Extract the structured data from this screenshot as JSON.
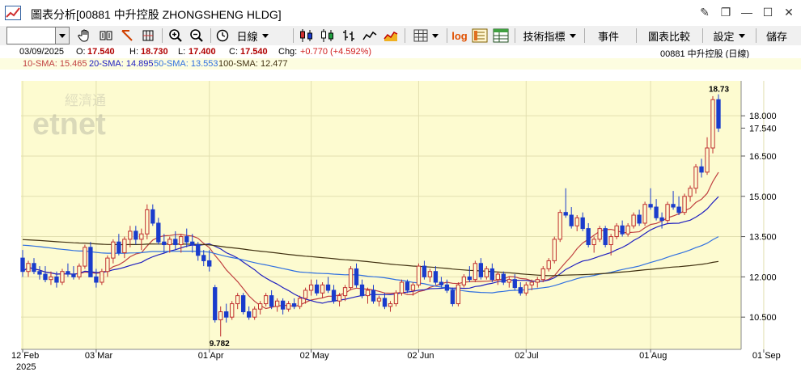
{
  "window": {
    "title": "圖表分析[00881 中升控股 ZHONGSHENG HLDG]",
    "controls": [
      "✎",
      "□",
      "—",
      "□",
      "✕"
    ]
  },
  "toolbar": {
    "period_label": "日線",
    "log_label": "log",
    "indicators_label": "技術指標",
    "events_label": "事件",
    "compare_label": "圖表比較",
    "settings_label": "設定",
    "save_label": "儲存"
  },
  "quote": {
    "date": "03/09/2025",
    "open_label": "O:",
    "open": "17.540",
    "high_label": "H:",
    "high": "18.730",
    "low_label": "L:",
    "low": "17.400",
    "close_label": "C:",
    "close": "17.540",
    "chg_label": "Chg:",
    "chg": "+0.770 (+4.592%)",
    "stock_label": "00881  中升控股 (日線)"
  },
  "sma": {
    "sma10_label": "10-SMA: 15.465",
    "sma20_label": "20-SMA: 14.895",
    "sma50_label": "50-SMA: 13.553",
    "sma100_label": "100-SMA: 12.477",
    "colors": {
      "sma10": "#c04040",
      "sma20": "#2020c0",
      "sma50": "#3070e0",
      "sma100": "#403010"
    }
  },
  "watermark": {
    "cn": "經濟通",
    "en": "etnet"
  },
  "chart_data": {
    "type": "candlestick",
    "title": "",
    "y_ticks": [
      "18.000",
      "16.500",
      "15.000",
      "13.500",
      "12.000",
      "10.500"
    ],
    "y_tick_values": [
      18.0,
      16.5,
      15.0,
      13.5,
      12.0,
      10.5
    ],
    "ylim": [
      9.3,
      19.3
    ],
    "last_price_label": "17.540",
    "last_price": 17.54,
    "high_annotation": "18.73",
    "low_annotation": "9.782",
    "x_ticks": [
      {
        "label": "12 Feb",
        "index": 0
      },
      {
        "label": "03 Mar",
        "index": 13
      },
      {
        "label": "01 Apr",
        "index": 33
      },
      {
        "label": "02 May",
        "index": 51
      },
      {
        "label": "02 Jun",
        "index": 70
      },
      {
        "label": "02 Jul",
        "index": 89
      },
      {
        "label": "01 Aug",
        "index": 111
      },
      {
        "label": "01 Sep",
        "index": 131
      }
    ],
    "year_label": "2025",
    "up_color": "#c03030",
    "down_color": "#1a3ccc",
    "candles": [
      [
        12.7,
        13.0,
        12.0,
        12.2
      ],
      [
        12.2,
        12.6,
        12.0,
        12.5
      ],
      [
        12.5,
        12.7,
        12.1,
        12.2
      ],
      [
        12.2,
        12.4,
        11.9,
        12.1
      ],
      [
        12.1,
        12.4,
        11.8,
        11.9
      ],
      [
        11.9,
        12.2,
        11.7,
        12.0
      ],
      [
        12.0,
        12.2,
        11.6,
        11.8
      ],
      [
        11.8,
        12.3,
        11.7,
        12.2
      ],
      [
        12.2,
        12.5,
        12.0,
        12.1
      ],
      [
        12.1,
        12.4,
        11.9,
        12.0
      ],
      [
        12.0,
        12.5,
        11.9,
        12.4
      ],
      [
        12.4,
        13.2,
        12.3,
        13.1
      ],
      [
        13.1,
        13.3,
        12.2,
        12.0
      ],
      [
        12.0,
        12.3,
        11.6,
        11.8
      ],
      [
        11.8,
        12.3,
        11.7,
        12.2
      ],
      [
        12.2,
        12.8,
        12.0,
        12.7
      ],
      [
        12.7,
        13.4,
        12.5,
        13.3
      ],
      [
        13.3,
        13.6,
        12.8,
        12.9
      ],
      [
        12.9,
        13.5,
        12.7,
        13.4
      ],
      [
        13.4,
        13.9,
        13.1,
        13.7
      ],
      [
        13.7,
        13.9,
        13.2,
        13.4
      ],
      [
        13.4,
        13.8,
        13.0,
        13.6
      ],
      [
        13.6,
        14.7,
        13.4,
        14.5
      ],
      [
        14.5,
        14.7,
        13.9,
        14.0
      ],
      [
        14.0,
        14.2,
        13.2,
        13.3
      ],
      [
        13.3,
        13.6,
        12.9,
        13.2
      ],
      [
        13.2,
        13.5,
        12.9,
        13.4
      ],
      [
        13.4,
        13.7,
        13.0,
        13.2
      ],
      [
        13.2,
        13.6,
        12.9,
        13.5
      ],
      [
        13.5,
        13.8,
        13.1,
        13.3
      ],
      [
        13.3,
        13.6,
        12.9,
        13.2
      ],
      [
        13.2,
        13.3,
        12.6,
        12.8
      ],
      [
        12.8,
        13.0,
        12.4,
        12.6
      ],
      [
        12.6,
        13.0,
        12.2,
        12.4
      ],
      [
        11.6,
        11.7,
        10.3,
        10.4
      ],
      [
        10.4,
        10.9,
        9.78,
        10.7
      ],
      [
        10.7,
        11.0,
        10.3,
        10.5
      ],
      [
        10.5,
        11.1,
        10.4,
        11.0
      ],
      [
        11.0,
        11.4,
        10.8,
        11.3
      ],
      [
        11.3,
        11.4,
        10.6,
        10.7
      ],
      [
        10.7,
        10.9,
        10.4,
        10.5
      ],
      [
        10.5,
        10.9,
        10.4,
        10.8
      ],
      [
        10.8,
        11.1,
        10.6,
        11.0
      ],
      [
        11.0,
        11.4,
        10.9,
        11.3
      ],
      [
        11.3,
        11.5,
        10.8,
        10.9
      ],
      [
        10.9,
        11.2,
        10.7,
        11.1
      ],
      [
        11.1,
        11.2,
        10.6,
        10.8
      ],
      [
        10.8,
        11.1,
        10.7,
        11.0
      ],
      [
        11.0,
        11.2,
        10.8,
        10.9
      ],
      [
        10.9,
        11.3,
        10.8,
        11.2
      ],
      [
        11.2,
        11.6,
        11.0,
        11.5
      ],
      [
        11.5,
        11.9,
        11.3,
        11.7
      ],
      [
        11.7,
        11.9,
        11.3,
        11.4
      ],
      [
        11.4,
        11.8,
        11.2,
        11.7
      ],
      [
        11.7,
        12.0,
        11.4,
        11.5
      ],
      [
        11.5,
        11.7,
        11.0,
        11.1
      ],
      [
        11.1,
        11.4,
        10.9,
        11.3
      ],
      [
        11.3,
        11.7,
        11.1,
        11.6
      ],
      [
        11.6,
        12.4,
        11.5,
        12.3
      ],
      [
        12.3,
        12.5,
        11.6,
        11.7
      ],
      [
        11.7,
        11.9,
        11.2,
        11.3
      ],
      [
        11.3,
        11.6,
        11.0,
        11.5
      ],
      [
        11.5,
        11.7,
        11.0,
        11.1
      ],
      [
        11.1,
        11.3,
        10.9,
        11.2
      ],
      [
        11.2,
        11.4,
        10.8,
        10.9
      ],
      [
        10.9,
        11.1,
        10.7,
        11.0
      ],
      [
        11.0,
        11.5,
        10.9,
        11.4
      ],
      [
        11.4,
        11.9,
        11.3,
        11.8
      ],
      [
        11.8,
        11.9,
        11.4,
        11.5
      ],
      [
        11.5,
        11.8,
        11.3,
        11.7
      ],
      [
        11.7,
        12.5,
        11.6,
        12.4
      ],
      [
        12.4,
        12.6,
        11.9,
        12.0
      ],
      [
        12.0,
        12.3,
        11.8,
        12.2
      ],
      [
        12.2,
        12.4,
        11.7,
        11.8
      ],
      [
        11.8,
        12.0,
        11.6,
        11.7
      ],
      [
        11.7,
        11.9,
        11.4,
        11.5
      ],
      [
        11.5,
        11.6,
        10.9,
        11.0
      ],
      [
        11.0,
        11.8,
        10.9,
        11.7
      ],
      [
        11.7,
        12.1,
        11.6,
        12.0
      ],
      [
        12.0,
        12.4,
        11.8,
        11.9
      ],
      [
        11.9,
        12.6,
        11.8,
        12.5
      ],
      [
        12.5,
        12.7,
        11.9,
        12.0
      ],
      [
        12.0,
        12.4,
        11.9,
        12.3
      ],
      [
        12.3,
        12.5,
        11.8,
        11.9
      ],
      [
        11.9,
        12.2,
        11.7,
        12.1
      ],
      [
        12.1,
        12.2,
        11.7,
        11.8
      ],
      [
        11.8,
        12.0,
        11.6,
        11.9
      ],
      [
        11.9,
        12.1,
        11.5,
        11.6
      ],
      [
        11.6,
        11.8,
        11.3,
        11.4
      ],
      [
        11.4,
        11.8,
        11.3,
        11.7
      ],
      [
        11.7,
        11.9,
        11.5,
        11.8
      ],
      [
        11.8,
        12.0,
        11.6,
        11.9
      ],
      [
        11.9,
        12.4,
        11.8,
        12.3
      ],
      [
        12.3,
        12.7,
        12.2,
        12.6
      ],
      [
        12.6,
        13.5,
        12.5,
        13.4
      ],
      [
        13.4,
        14.5,
        13.3,
        14.4
      ],
      [
        14.4,
        15.3,
        14.2,
        14.3
      ],
      [
        14.3,
        14.6,
        13.8,
        13.9
      ],
      [
        13.9,
        14.3,
        13.7,
        14.2
      ],
      [
        14.2,
        14.4,
        13.7,
        13.8
      ],
      [
        13.8,
        14.0,
        13.1,
        13.2
      ],
      [
        13.2,
        13.5,
        12.9,
        13.4
      ],
      [
        13.4,
        13.9,
        13.3,
        13.8
      ],
      [
        13.8,
        13.9,
        13.1,
        13.2
      ],
      [
        13.2,
        13.6,
        12.8,
        13.5
      ],
      [
        13.5,
        14.0,
        13.4,
        13.9
      ],
      [
        13.9,
        14.1,
        13.5,
        13.6
      ],
      [
        13.6,
        14.0,
        13.5,
        13.9
      ],
      [
        13.9,
        14.4,
        13.8,
        14.3
      ],
      [
        14.3,
        14.5,
        13.9,
        14.0
      ],
      [
        14.0,
        14.8,
        13.9,
        14.7
      ],
      [
        14.7,
        15.3,
        14.5,
        14.6
      ],
      [
        14.6,
        14.9,
        14.1,
        14.2
      ],
      [
        14.2,
        14.4,
        13.8,
        14.1
      ],
      [
        14.1,
        14.8,
        14.0,
        14.7
      ],
      [
        14.7,
        15.2,
        14.5,
        14.6
      ],
      [
        14.6,
        15.0,
        14.3,
        14.4
      ],
      [
        14.4,
        15.1,
        14.3,
        15.0
      ],
      [
        15.0,
        15.4,
        14.8,
        15.3
      ],
      [
        15.3,
        16.2,
        15.1,
        16.1
      ],
      [
        16.1,
        16.4,
        15.7,
        15.9
      ],
      [
        15.9,
        17.2,
        15.8,
        16.8
      ],
      [
        16.8,
        18.73,
        16.6,
        18.6
      ],
      [
        18.6,
        18.8,
        17.4,
        17.54
      ]
    ]
  }
}
